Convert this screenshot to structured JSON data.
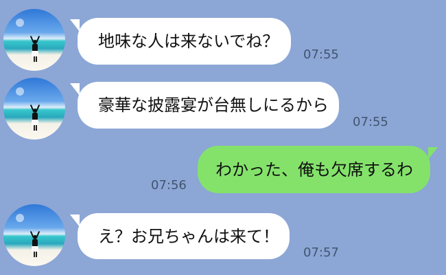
{
  "conversation": {
    "messages": [
      {
        "side": "incoming",
        "text": "地味な人は来ないでね？",
        "time": "07:55"
      },
      {
        "side": "incoming",
        "text": "豪華な披露宴が台無しにるから",
        "time": "07:55"
      },
      {
        "side": "outgoing",
        "text": "わかった、俺も欠席するわ",
        "time": "07:56"
      },
      {
        "side": "incoming",
        "text": "え？お兄ちゃんは来て！",
        "time": "07:57"
      }
    ]
  },
  "theme": {
    "background": "#8ca6d6",
    "incoming_bubble": "#ffffff",
    "outgoing_bubble": "#84e26b",
    "timestamp_color": "#41556f"
  }
}
